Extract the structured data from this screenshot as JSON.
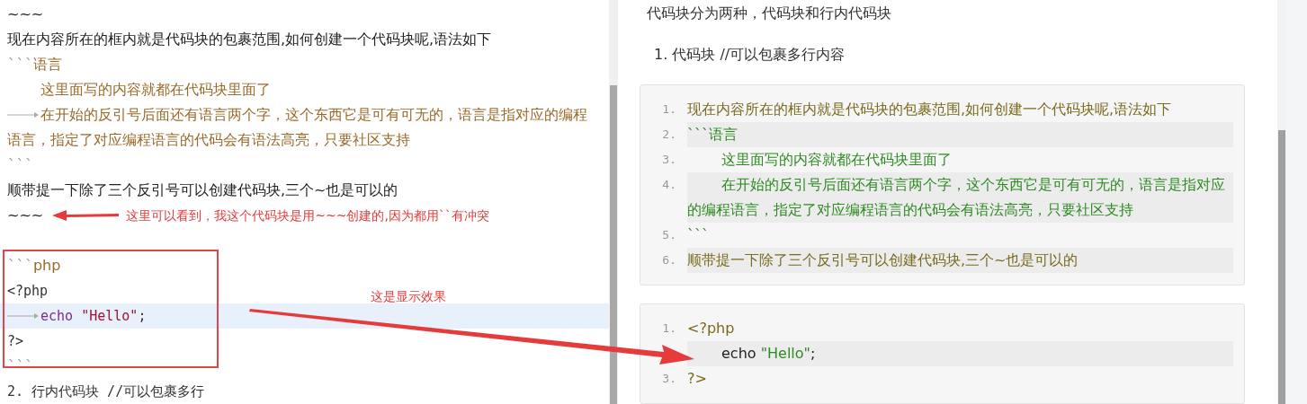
{
  "editor": {
    "lines": [
      {
        "tab": false,
        "indent": false,
        "selected": false,
        "segments": [
          {
            "kind": "text",
            "text": "~~~"
          }
        ]
      },
      {
        "tab": false,
        "indent": false,
        "selected": false,
        "segments": [
          {
            "kind": "text",
            "text": "现在内容所在的框内就是代码块的包裹范围,如何创建一个代码块呢,语法如下"
          }
        ]
      },
      {
        "tab": false,
        "indent": false,
        "selected": false,
        "segments": [
          {
            "kind": "fence",
            "text": "```"
          },
          {
            "kind": "lang",
            "text": "语言"
          }
        ]
      },
      {
        "tab": false,
        "indent": true,
        "selected": false,
        "segments": [
          {
            "kind": "code",
            "text": "这里面写的内容就都在代码块里面了"
          }
        ]
      },
      {
        "tab": true,
        "indent": true,
        "selected": false,
        "segments": [
          {
            "kind": "code",
            "text": "在开始的反引号后面还有语言两个字，这个东西它是可有可无的，语言是指对应的编程语言，指定了对应编程语言的代码会有语法高亮，只要社区支持"
          }
        ]
      },
      {
        "tab": false,
        "indent": false,
        "selected": false,
        "segments": [
          {
            "kind": "fence",
            "text": "```"
          }
        ]
      },
      {
        "tab": false,
        "indent": false,
        "selected": false,
        "segments": [
          {
            "kind": "text",
            "text": "顺带提一下除了三个反引号可以创建代码块,三个~也是可以的"
          }
        ]
      },
      {
        "tab": false,
        "indent": false,
        "selected": false,
        "note": "这里可以看到，我这个代码块是用~~~创建的,因为都用``有冲突",
        "segments": [
          {
            "kind": "text",
            "text": "~~~"
          }
        ]
      },
      {
        "selected": false
      },
      {
        "tab": false,
        "indent": false,
        "selected": false,
        "segments": [
          {
            "kind": "fence",
            "text": "```"
          },
          {
            "kind": "lang",
            "text": "php"
          }
        ]
      },
      {
        "tab": false,
        "indent": false,
        "selected": false,
        "segments": [
          {
            "kind": "mono",
            "text": "<?php"
          }
        ]
      },
      {
        "tab": true,
        "indent": true,
        "selected": true,
        "segments": [
          {
            "kind": "keyword",
            "text": "echo "
          },
          {
            "kind": "string",
            "text": "\"Hello\""
          },
          {
            "kind": "mono",
            "text": ";"
          }
        ]
      },
      {
        "tab": false,
        "indent": false,
        "selected": false,
        "segments": [
          {
            "kind": "mono",
            "text": "?>"
          }
        ]
      },
      {
        "tab": false,
        "indent": false,
        "selected": false,
        "segments": [
          {
            "kind": "fence",
            "text": "```"
          }
        ]
      },
      {
        "tab": false,
        "indent": false,
        "selected": false,
        "segments": [
          {
            "kind": "mono",
            "text": "2. 行内代码块 //可以包裹多行"
          }
        ]
      }
    ],
    "effect_note": "这是显示效果"
  },
  "preview": {
    "intro": "代码块分为两种，代码块和行内代码块",
    "list_item": "1. 代码块 //可以包裹多行内容",
    "code_blocks": [
      {
        "lines": [
          {
            "number": "1.",
            "indent": false,
            "segments": [
              {
                "kind": "olive",
                "text": "现在内容所在的框内就是代码块的包裹范围,如何创建一个代码块呢,语法如下"
              }
            ]
          },
          {
            "number": "2.",
            "indent": false,
            "segments": [
              {
                "kind": "green",
                "text": "```语言"
              }
            ]
          },
          {
            "number": "3.",
            "indent": true,
            "segments": [
              {
                "kind": "green",
                "text": "这里面写的内容就都在代码块里面了"
              }
            ]
          },
          {
            "number": "4.",
            "indent": true,
            "segments": [
              {
                "kind": "green",
                "text": "在开始的反引号后面还有语言两个字，这个东西它是可有可无的，语言是指对应的编程语言，指定了对应编程语言的代码会有语法高亮，只要社区支持"
              }
            ]
          },
          {
            "number": "5.",
            "indent": false,
            "segments": [
              {
                "kind": "green",
                "text": "```"
              }
            ]
          },
          {
            "number": "6.",
            "indent": false,
            "segments": [
              {
                "kind": "olive",
                "text": "顺带提一下除了三个反引号可以创建代码块,三个~也是可以的"
              }
            ]
          }
        ]
      },
      {
        "lines": [
          {
            "number": "1.",
            "indent": false,
            "segments": [
              {
                "kind": "olive",
                "text": "<?php"
              }
            ]
          },
          {
            "indent": true,
            "segments": [
              {
                "kind": "dark",
                "text": "echo "
              },
              {
                "kind": "green",
                "text": "\"Hello\""
              },
              {
                "kind": "dark",
                "text": ";"
              }
            ]
          },
          {
            "number": "3.",
            "indent": false,
            "segments": [
              {
                "kind": "olive",
                "text": "?>"
              }
            ]
          }
        ]
      }
    ]
  }
}
